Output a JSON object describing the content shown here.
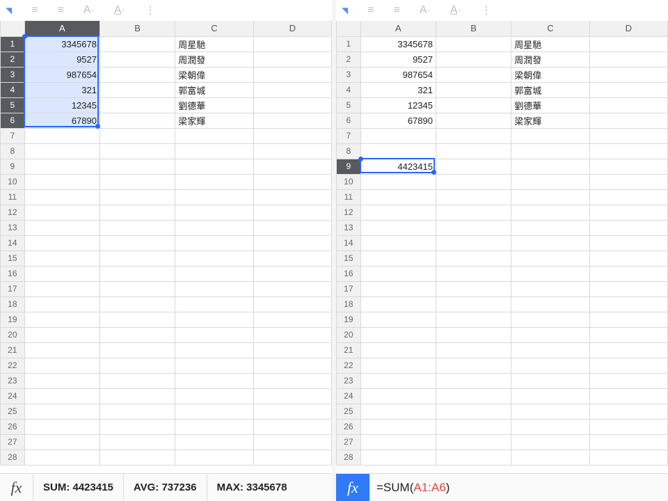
{
  "columns": [
    "A",
    "B",
    "C",
    "D"
  ],
  "row_count": 28,
  "left": {
    "sel_rows": [
      1,
      2,
      3,
      4,
      5,
      6
    ],
    "sel_col": "A",
    "cells": {
      "A1": "3345678",
      "A2": "9527",
      "A3": "987654",
      "A4": "321",
      "A5": "12345",
      "A6": "67890",
      "C1": "周星馳",
      "C2": "周潤發",
      "C3": "梁朝偉",
      "C4": "郭富城",
      "C5": "劉德華",
      "C6": "梁家輝"
    },
    "stats": {
      "sum_label": "SUM:",
      "sum": "4423415",
      "avg_label": "AVG:",
      "avg": "737236",
      "max_label": "MAX:",
      "max": "3345678"
    },
    "fx_label": "fx"
  },
  "right": {
    "active_cell": "A9",
    "active_row": 9,
    "cells": {
      "A1": "3345678",
      "A2": "9527",
      "A3": "987654",
      "A4": "321",
      "A5": "12345",
      "A6": "67890",
      "A9": "4423415",
      "C1": "周星馳",
      "C2": "周潤發",
      "C3": "梁朝偉",
      "C4": "郭富城",
      "C5": "劉德華",
      "C6": "梁家輝"
    },
    "formula": {
      "prefix": "=SUM(",
      "range": "A1:A6",
      "suffix": ")"
    },
    "fx_label": "fx"
  },
  "toolbar_icons": [
    "drop",
    "align",
    "align",
    "font",
    "style",
    "more"
  ]
}
